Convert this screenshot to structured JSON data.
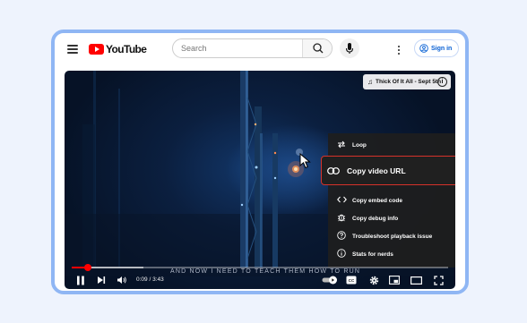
{
  "header": {
    "logo_text": "YouTube",
    "search_placeholder": "Search",
    "signin_label": "Sign in"
  },
  "player": {
    "song_badge": "Thick Of It All - Sept 5th",
    "subtitle": "AND NOW I NEED TO TEACH THEM HOW TO RUN",
    "time_display": "0:09 / 3:43",
    "progress_played_fraction": 0.043,
    "progress_loaded_fraction": 0.19
  },
  "context_menu": {
    "items": [
      {
        "label": "Loop",
        "icon": "loop-icon"
      },
      {
        "label": "Copy video URL",
        "icon": "link-icon",
        "highlighted": true
      },
      {
        "label": "Copy embed code",
        "icon": "embed-code-icon"
      },
      {
        "label": "Copy debug info",
        "icon": "bug-icon"
      },
      {
        "label": "Troubleshoot playback issue",
        "icon": "question-icon"
      },
      {
        "label": "Stats for nerds",
        "icon": "info-icon"
      }
    ]
  },
  "colors": {
    "accent_red": "#ff0000",
    "highlight_border": "#d6322a",
    "frame_border": "#8fb6f4",
    "signin_blue": "#065fd4"
  }
}
